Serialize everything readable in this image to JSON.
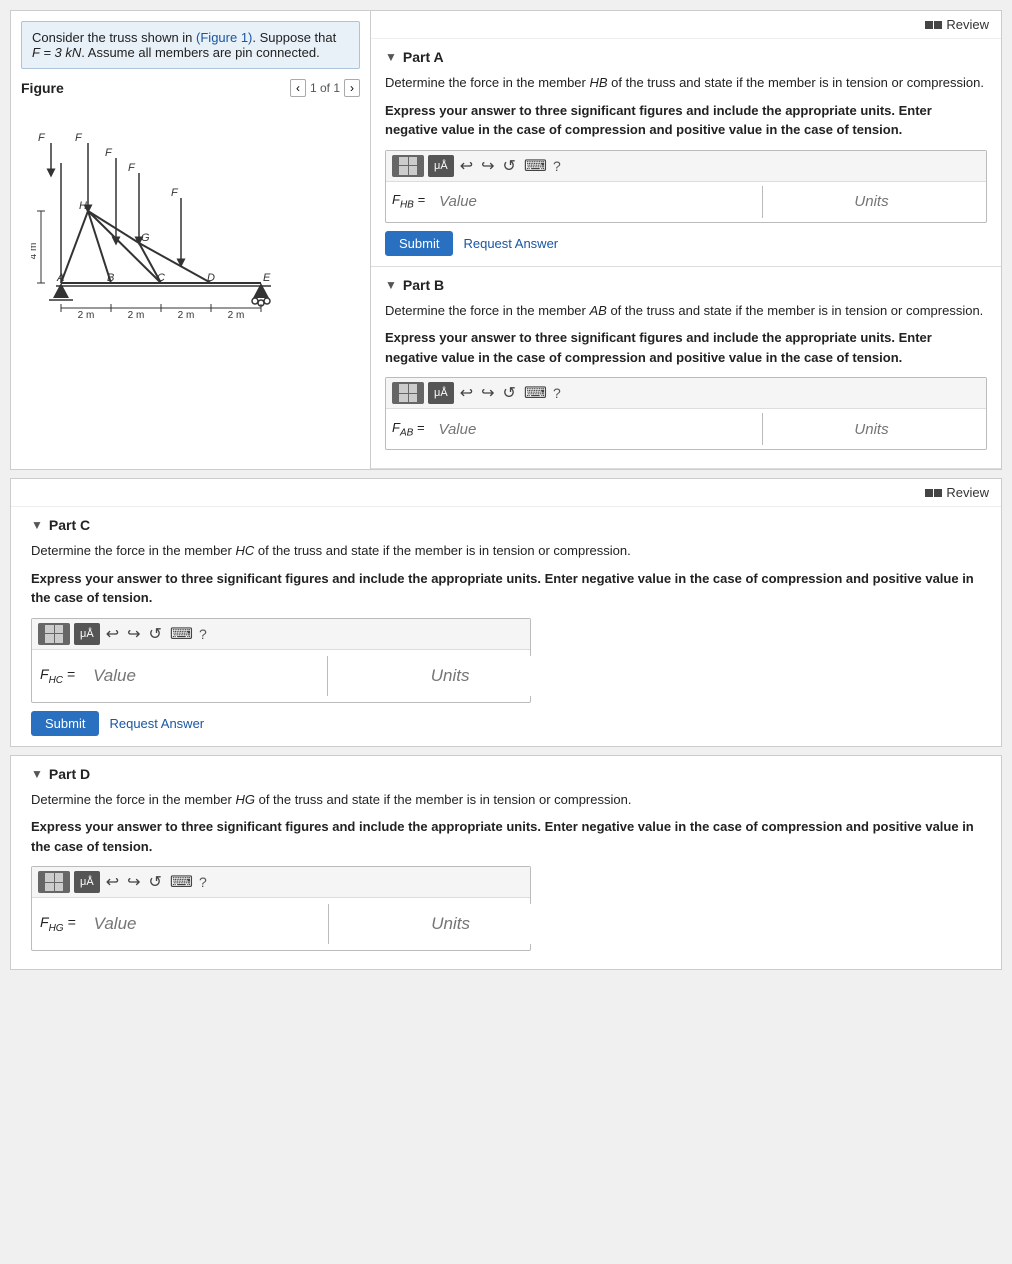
{
  "review": {
    "label": "Review"
  },
  "problem": {
    "statement_prefix": "Consider the truss shown in ",
    "figure_link": "(Figure 1)",
    "statement_suffix": ". Suppose that",
    "equation": "F = 3  kN",
    "statement_end": ". Assume all members are pin connected."
  },
  "figure": {
    "label": "Figure",
    "nav": "1 of 1"
  },
  "parts": {
    "a": {
      "header": "Part A",
      "description": "Determine the force in the member HB of the truss and state if the member is in tension or compression.",
      "instructions": "Express your answer to three significant figures and include the appropriate units. Enter negative value in the case of compression and positive value in the case of tension.",
      "label": "F_HB =",
      "value_placeholder": "Value",
      "units_placeholder": "Units",
      "submit_label": "Submit",
      "request_label": "Request Answer"
    },
    "b": {
      "header": "Part B",
      "description": "Determine the force in the member AB of the truss and state if the member is in tension or compression.",
      "instructions": "Express your answer to three significant figures and include the appropriate units. Enter negative value in the case of compression and positive value in the case of tension.",
      "label": "F_AB =",
      "value_placeholder": "Value",
      "units_placeholder": "Units"
    },
    "c": {
      "header": "Part C",
      "description": "Determine the force in the member HC of the truss and state if the member is in tension or compression.",
      "instructions": "Express your answer to three significant figures and include the appropriate units. Enter negative value in the case of compression and positive value in the case of tension.",
      "label": "F_HC =",
      "value_placeholder": "Value",
      "units_placeholder": "Units",
      "submit_label": "Submit",
      "request_label": "Request Answer"
    },
    "d": {
      "header": "Part D",
      "description": "Determine the force in the member HG of the truss and state if the member is in tension or compression.",
      "instructions": "Express your answer to three significant figures and include the appropriate units. Enter negative value in the case of compression and positive value in the case of tension.",
      "label": "F_HG =",
      "value_placeholder": "Value",
      "units_placeholder": "Units"
    }
  },
  "toolbar": {
    "mu_a": "μÅ",
    "undo": "↩",
    "redo": "↪",
    "refresh": "↺",
    "keyboard": "⌨",
    "help": "?"
  }
}
